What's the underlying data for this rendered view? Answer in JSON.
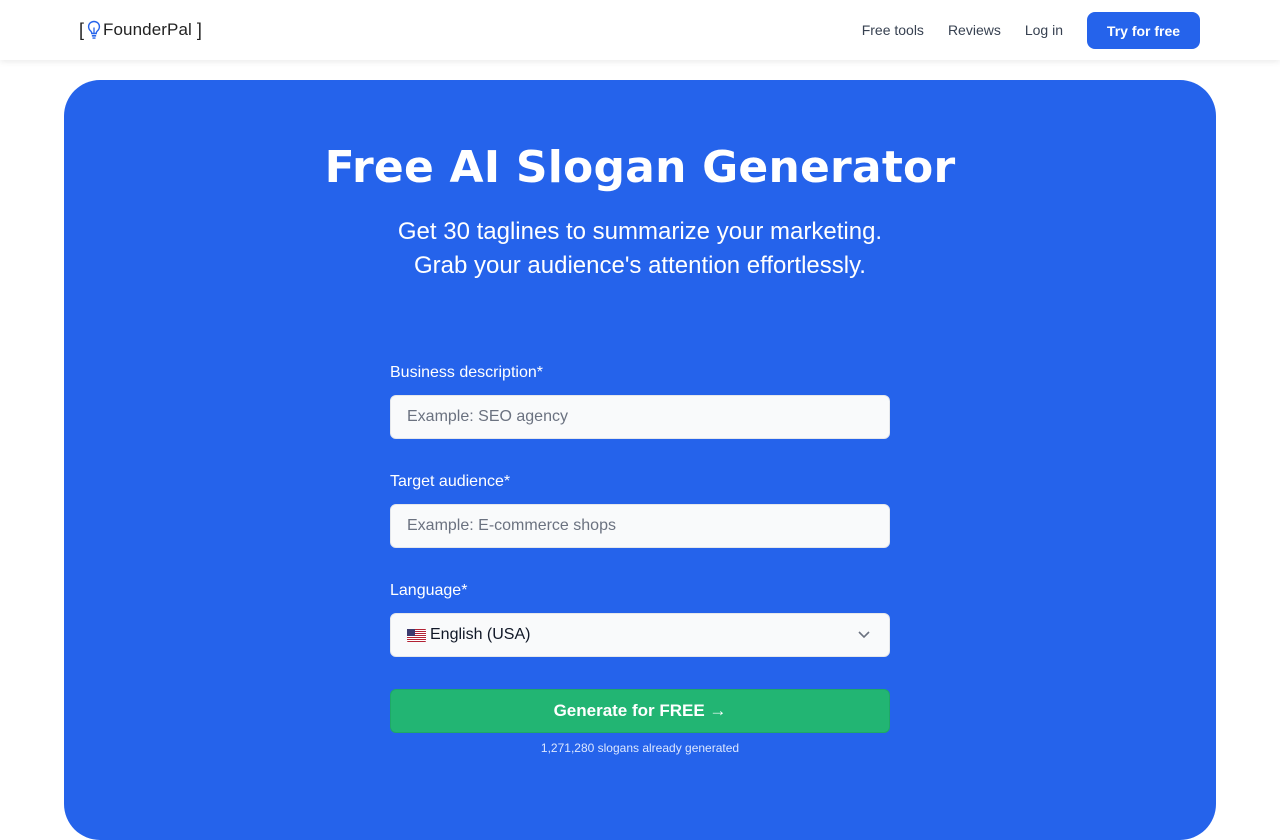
{
  "header": {
    "logo_text": "FounderPal",
    "nav": [
      "Free tools",
      "Reviews",
      "Log in"
    ],
    "cta": "Try for free"
  },
  "hero": {
    "title": "Free AI Slogan Generator",
    "subtitle_line1": "Get 30 taglines to summarize your marketing.",
    "subtitle_line2": "Grab your audience's attention effortlessly."
  },
  "form": {
    "business": {
      "label": "Business description*",
      "placeholder": "Example: SEO agency",
      "value": ""
    },
    "audience": {
      "label": "Target audience*",
      "placeholder": "Example: E-commerce shops",
      "value": ""
    },
    "language": {
      "label": "Language*",
      "selected": "English (USA)",
      "flag": "us-flag-icon"
    },
    "submit": "Generate for FREE →",
    "counter": "1,271,280 slogans already generated"
  },
  "colors": {
    "brand_blue": "#2563eb",
    "submit_green": "#22b573",
    "header_bg": "#ffffff"
  }
}
